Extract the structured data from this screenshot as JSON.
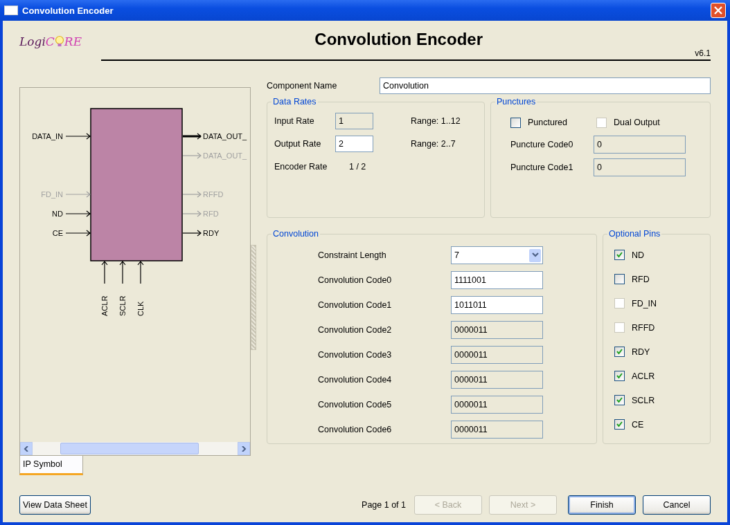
{
  "window": {
    "title": "Convolution Encoder"
  },
  "header": {
    "logo": [
      "Logi",
      "C",
      "RE"
    ],
    "title": "Convolution Encoder",
    "version": "v6.1"
  },
  "symbol": {
    "inputs": {
      "data": [
        {
          "label": "DATA_IN",
          "enabled": true
        }
      ],
      "control": [
        {
          "label": "FD_IN",
          "enabled": false
        },
        {
          "label": "ND",
          "enabled": true
        },
        {
          "label": "CE",
          "enabled": true
        }
      ]
    },
    "outputs": {
      "data": [
        {
          "label": "DATA_OUT_",
          "enabled": true,
          "kind": "bus"
        },
        {
          "label": "DATA_OUT_",
          "enabled": false,
          "kind": "signal"
        }
      ],
      "control": [
        {
          "label": "RFFD",
          "enabled": false,
          "kind": "signal"
        },
        {
          "label": "RFD",
          "enabled": false,
          "kind": "signal"
        },
        {
          "label": "RDY",
          "enabled": true,
          "kind": "signal"
        }
      ]
    },
    "bottom": [
      {
        "label": "ACLR",
        "enabled": true
      },
      {
        "label": "SCLR",
        "enabled": true
      },
      {
        "label": "CLK",
        "enabled": true
      }
    ]
  },
  "view_tabs": [
    {
      "label": "IP Symbol",
      "selected": true
    }
  ],
  "component_name": {
    "label": "Component Name",
    "value": "Convolution"
  },
  "data_rates": {
    "title": "Data Rates",
    "rows": [
      {
        "kind": "field",
        "label": "Input Rate",
        "value": "1",
        "disabled": true,
        "range": "Range: 1..12"
      },
      {
        "kind": "field",
        "label": "Output Rate",
        "value": "2",
        "disabled": false,
        "range": "Range: 2..7"
      },
      {
        "kind": "text",
        "label": "Encoder Rate",
        "value": "1 / 2"
      }
    ]
  },
  "punctures": {
    "title": "Punctures",
    "options": [
      {
        "label": "Punctured",
        "checked": false,
        "disabled": false
      },
      {
        "label": "Dual Output",
        "checked": false,
        "disabled": true
      }
    ],
    "codes": [
      {
        "label": "Puncture Code0",
        "value": "0",
        "disabled": true
      },
      {
        "label": "Puncture Code1",
        "value": "0",
        "disabled": true
      }
    ]
  },
  "convolution": {
    "title": "Convolution",
    "rows": [
      {
        "kind": "dropdown",
        "label": "Constraint Length",
        "value": "7",
        "disabled": false
      },
      {
        "kind": "field",
        "label": "Convolution Code0",
        "value": "1111001",
        "disabled": false
      },
      {
        "kind": "field",
        "label": "Convolution Code1",
        "value": "1011011",
        "disabled": false
      },
      {
        "kind": "field",
        "label": "Convolution Code2",
        "value": "0000011",
        "disabled": true
      },
      {
        "kind": "field",
        "label": "Convolution Code3",
        "value": "0000011",
        "disabled": true
      },
      {
        "kind": "field",
        "label": "Convolution Code4",
        "value": "0000011",
        "disabled": true
      },
      {
        "kind": "field",
        "label": "Convolution Code5",
        "value": "0000011",
        "disabled": true
      },
      {
        "kind": "field",
        "label": "Convolution Code6",
        "value": "0000011",
        "disabled": true
      }
    ]
  },
  "optional_pins": {
    "title": "Optional Pins",
    "pins": [
      {
        "label": "ND",
        "checked": true,
        "disabled": false
      },
      {
        "label": "RFD",
        "checked": false,
        "disabled": false
      },
      {
        "label": "FD_IN",
        "checked": false,
        "disabled": true
      },
      {
        "label": "RFFD",
        "checked": false,
        "disabled": true
      },
      {
        "label": "RDY",
        "checked": true,
        "disabled": false
      },
      {
        "label": "ACLR",
        "checked": true,
        "disabled": false
      },
      {
        "label": "SCLR",
        "checked": true,
        "disabled": false
      },
      {
        "label": "CE",
        "checked": true,
        "disabled": false
      }
    ]
  },
  "footer": {
    "datasheet": "View Data Sheet",
    "page": "Page 1 of 1",
    "buttons": [
      {
        "label": "< Back",
        "disabled": true,
        "default": false
      },
      {
        "label": "Next >",
        "disabled": true,
        "default": false
      },
      {
        "label": "Finish",
        "disabled": false,
        "default": true
      },
      {
        "label": "Cancel",
        "disabled": false,
        "default": false
      }
    ]
  }
}
